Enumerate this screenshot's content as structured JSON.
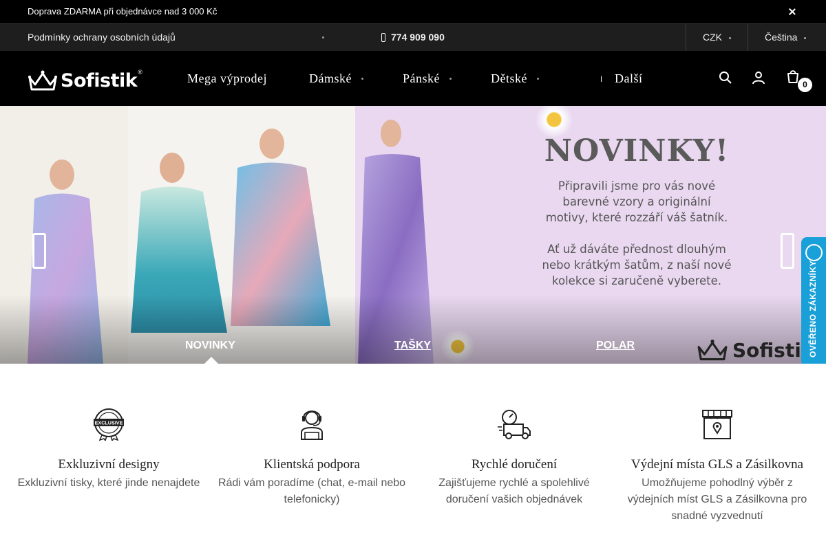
{
  "announcement": {
    "text": "Doprava ZDARMA při objednávce nad 3 000 Kč "
  },
  "infobar": {
    "privacy_label": "Podmínky ochrany osobních údajů",
    "phone": "774 909 090",
    "currency": "CZK",
    "language": "Čeština"
  },
  "header": {
    "logo_text": "Sofistik",
    "logo_reg": "®",
    "nav": [
      {
        "label": "Mega výprodej"
      },
      {
        "label": "Dámské"
      },
      {
        "label": "Pánské"
      },
      {
        "label": "Dětské"
      },
      {
        "label": "Další"
      }
    ],
    "cart_count": "0",
    "icons": [
      "search-icon",
      "user-icon",
      "cart-icon"
    ]
  },
  "hero": {
    "title": "NOVINKY!",
    "paragraph1": [
      "Připravili jsme pro vás nové",
      "barevné vzory a originální",
      "motivy, které rozzáří váš šatník."
    ],
    "paragraph2": [
      "Ať už dáváte přednost dlouhým",
      "nebo krátkým šatům, z naší nové",
      "kolekce si zaručeně vyberete."
    ],
    "tabs": [
      {
        "label": "NOVINKY",
        "active": true
      },
      {
        "label": "TAŠKY",
        "active": false
      },
      {
        "label": "POLAR",
        "active": false
      }
    ],
    "watermark_logo": "Sofistik",
    "background_color": "#e9d8f0"
  },
  "verified_badge": {
    "text": "OVĚŘENO ZÁKAZNÍKY",
    "color": "#1aa0d8"
  },
  "features": [
    {
      "icon": "exclusive-badge-icon",
      "badge_text": "EXCLUSIVE",
      "title": "Exkluzivní designy",
      "desc": [
        "Exkluzivní tisky, které jinde nenajdete"
      ]
    },
    {
      "icon": "support-agent-icon",
      "title": "Klientská podpora",
      "desc": [
        "Rádi vám poradíme (chat, e-mail nebo",
        "telefonicky)"
      ]
    },
    {
      "icon": "delivery-truck-icon",
      "title": "Rychlé doručení",
      "desc": [
        "Zajišťujeme rychlé a spolehlivé",
        "doručení vašich objednávek"
      ]
    },
    {
      "icon": "pickup-store-icon",
      "title": "Výdejní místa GLS a Zásilkovna",
      "desc": [
        "Umožňujeme pohodlný výběr z",
        "výdejních míst GLS a Zásilkovna pro",
        "snadné vyzvednutí"
      ]
    }
  ]
}
